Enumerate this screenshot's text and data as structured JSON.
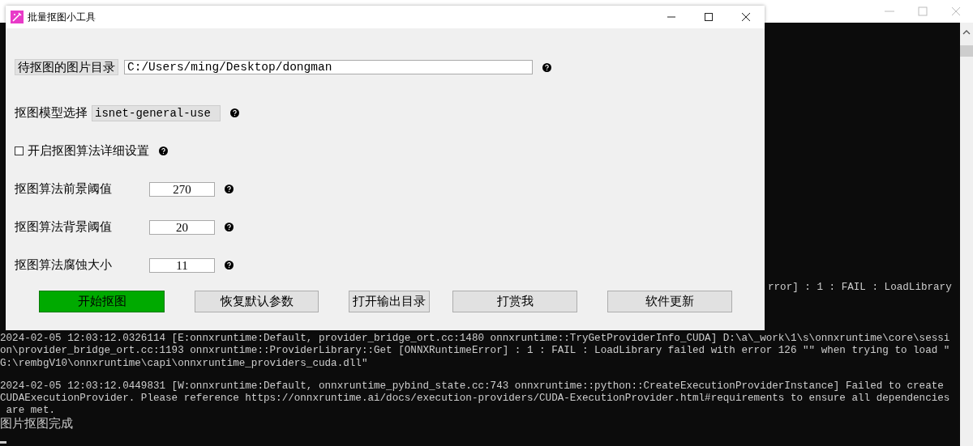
{
  "console": {
    "fragment": "rror] : 1 : FAIL : LoadLibrary",
    "blocks": [
      [
        "2024-02-05 12:03:12.0326114 [E:onnxruntime:Default, provider_bridge_ort.cc:1480 onnxruntime::TryGetProviderInfo_CUDA] D:\\a\\_work\\1\\s\\onnxruntime\\core\\sessi",
        "on\\provider_bridge_ort.cc:1193 onnxruntime::ProviderLibrary::Get [ONNXRuntimeError] : 1 : FAIL : LoadLibrary failed with error 126 \"\" when trying to load \"",
        "G:\\rembgV10\\onnxruntime\\capi\\onnxruntime_providers_cuda.dll\""
      ],
      [
        "2024-02-05 12:03:12.0449831 [W:onnxruntime:Default, onnxruntime_pybind_state.cc:743 onnxruntime::python::CreateExecutionProviderInstance] Failed to create",
        "CUDAExecutionProvider. Please reference https://onnxruntime.ai/docs/execution-providers/CUDA-ExecutionProvider.html#requirements to ensure all dependencies",
        " are met.",
        "图片抠图完成"
      ]
    ]
  },
  "app": {
    "title": "批量抠图小工具",
    "fields": [
      {
        "kind": "folder",
        "label": "待抠图的图片目录",
        "value": "C:/Users/ming/Desktop/dongman"
      },
      {
        "kind": "select",
        "label": "抠图模型选择",
        "value": "isnet-general-use"
      },
      {
        "kind": "checkbox",
        "label": "开启抠图算法详细设置",
        "checked": false
      },
      {
        "kind": "number",
        "label": "抠图算法前景阈值",
        "value": "270"
      },
      {
        "kind": "number",
        "label": "抠图算法背景阈值",
        "value": "20"
      },
      {
        "kind": "number",
        "label": "抠图算法腐蚀大小",
        "value": "11"
      }
    ],
    "buttons": [
      {
        "label": "开始抠图",
        "primary": true
      },
      {
        "label": "恢复默认参数",
        "primary": false
      },
      {
        "label": "打开输出目录",
        "primary": false
      },
      {
        "label": "打赏我",
        "primary": false
      },
      {
        "label": "软件更新",
        "primary": false
      }
    ]
  }
}
